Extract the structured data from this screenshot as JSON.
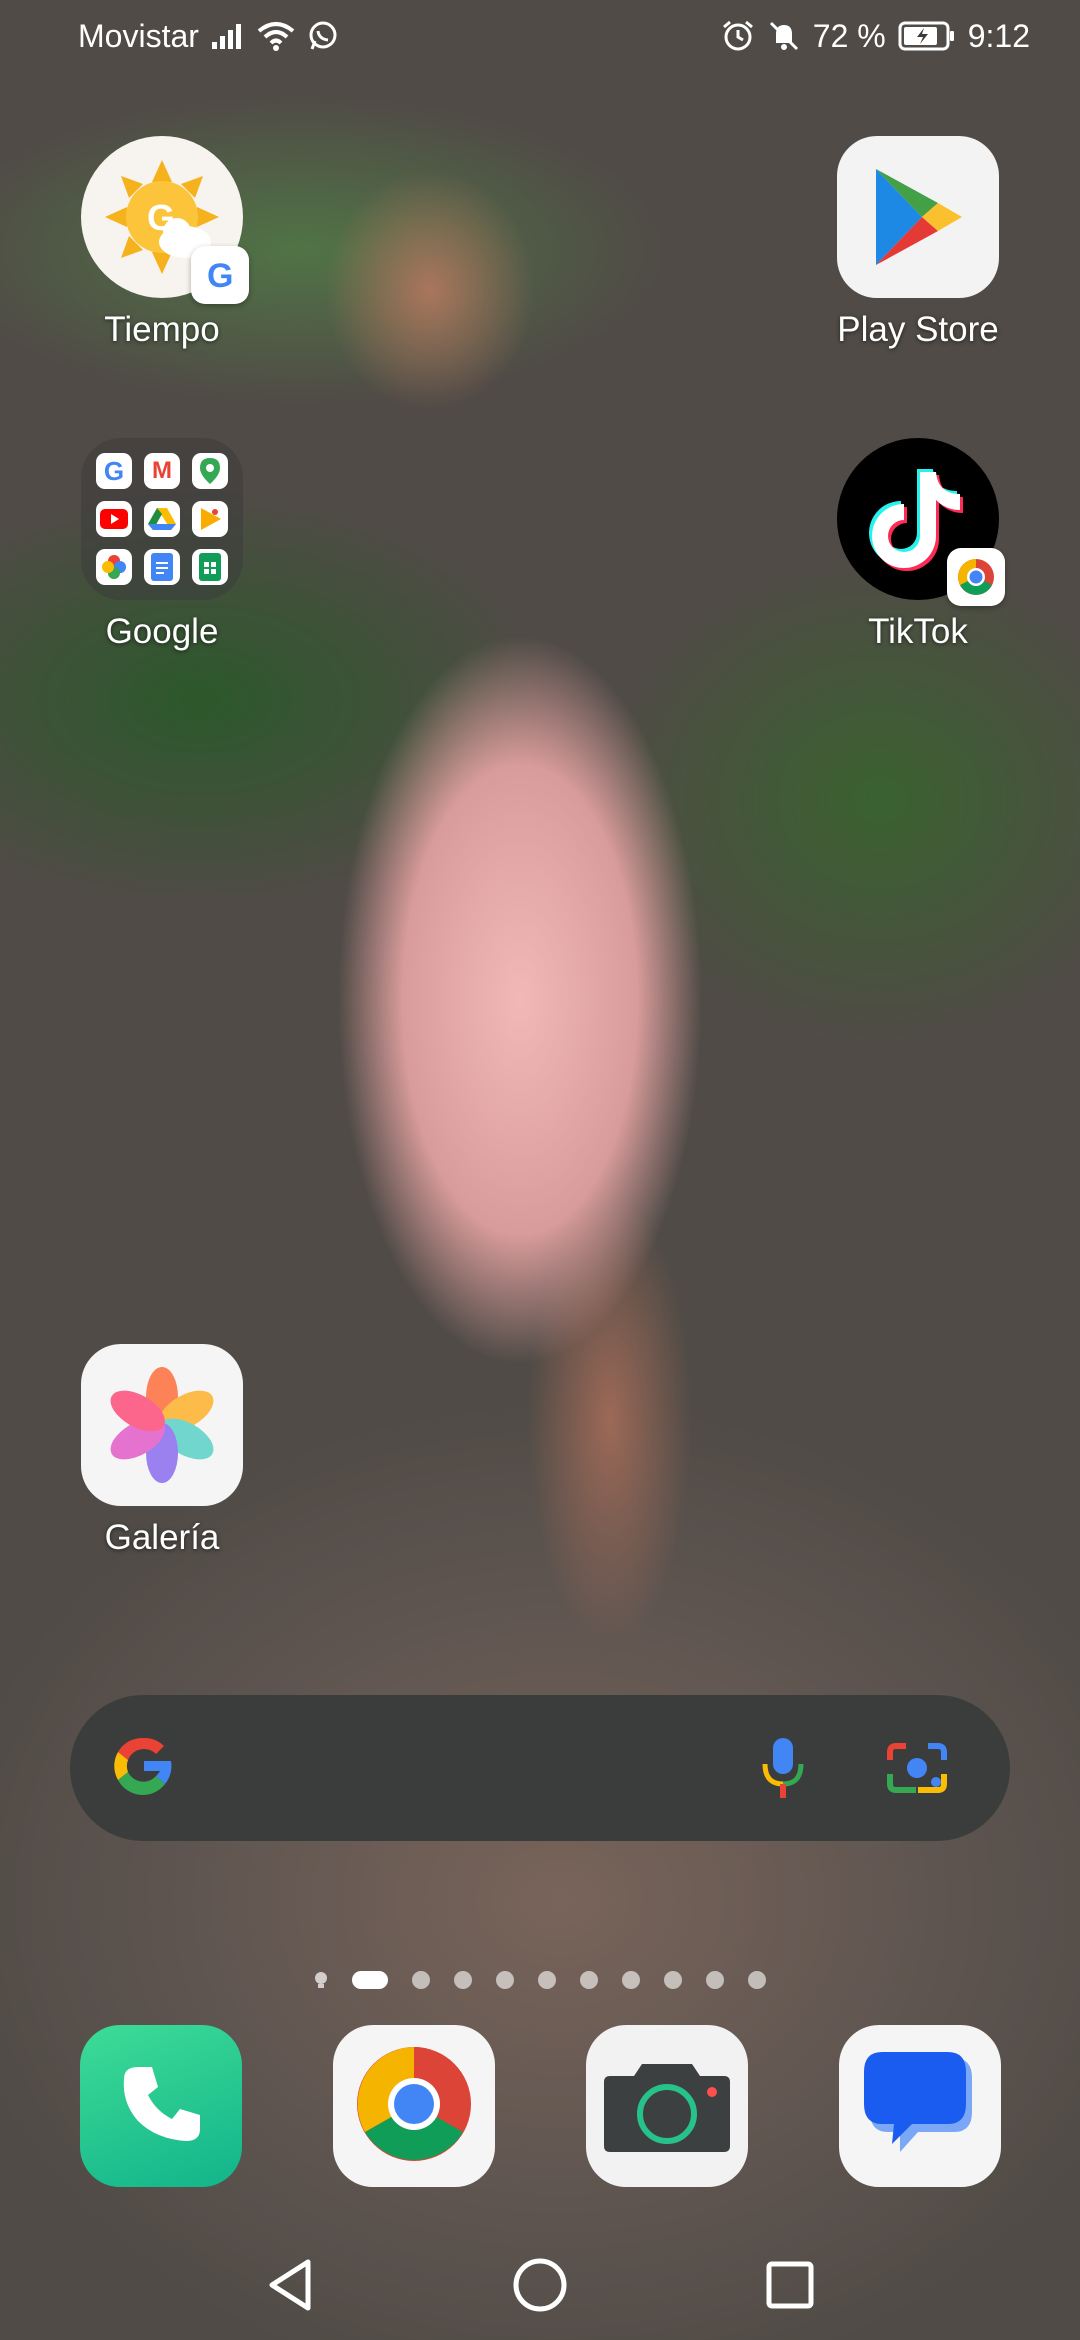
{
  "status_bar": {
    "carrier": "Movistar",
    "battery": "72 %",
    "time": "9:12",
    "icons": [
      "signal-icon",
      "wifi-icon",
      "whatsapp-icon",
      "alarm-icon",
      "mute-icon",
      "battery-icon"
    ]
  },
  "apps": {
    "weather": {
      "label": "Tiempo"
    },
    "play_store": {
      "label": "Play Store"
    },
    "google_folder": {
      "label": "Google"
    },
    "tiktok": {
      "label": "TikTok"
    },
    "gallery": {
      "label": "Galería"
    }
  },
  "search": {
    "logo": "google-g-icon",
    "mic": "microphone-icon",
    "lens": "google-lens-icon"
  },
  "pager": {
    "total_pages": 10,
    "active_page": 1
  },
  "dock": [
    "phone-icon",
    "chrome-icon",
    "camera-icon",
    "messages-icon"
  ],
  "nav": [
    "back-button",
    "home-button",
    "recents-button"
  ]
}
